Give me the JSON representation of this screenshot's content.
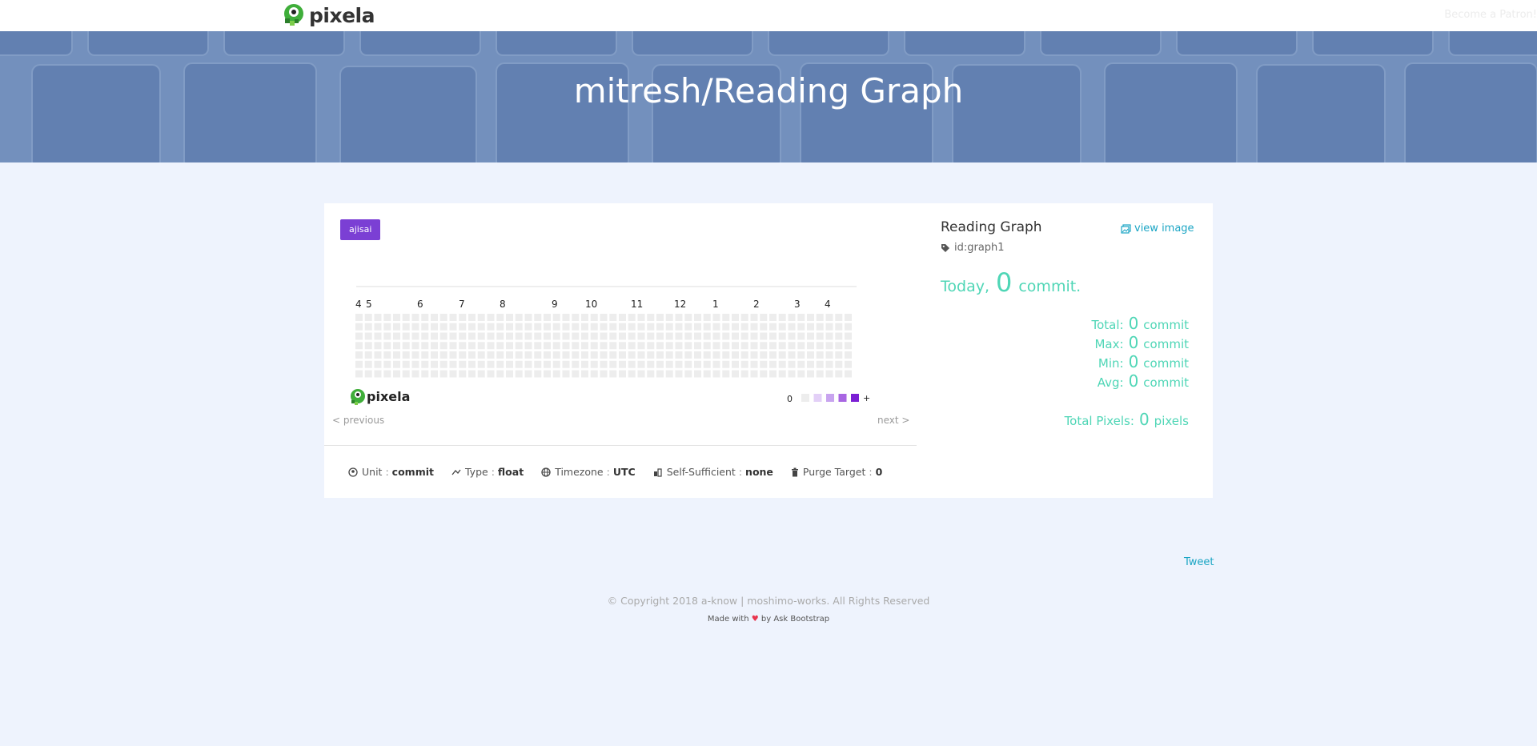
{
  "navbar": {
    "brand": "pixela",
    "patron_link": "Become a Patron!"
  },
  "hero": {
    "title": "mitresh/Reading Graph"
  },
  "graph": {
    "theme_badge": "ajisai",
    "month_labels": [
      "4",
      "5",
      "6",
      "7",
      "8",
      "9",
      "10",
      "11",
      "12",
      "1",
      "2",
      "3",
      "4"
    ],
    "brand": "pixela",
    "legend_low": "0",
    "legend_high": "+",
    "legend_colors": [
      "#ededed",
      "#e3d0f7",
      "#c8a4ef",
      "#a866e2",
      "#7b1fd4"
    ],
    "empty_cell_color": "#ededed",
    "weeks": 53,
    "prev_link": "< previous",
    "next_link": "next >"
  },
  "properties": {
    "unit_label": "Unit",
    "unit_value": "commit",
    "type_label": "Type",
    "type_value": "float",
    "timezone_label": "Timezone",
    "timezone_value": "UTC",
    "self_sufficient_label": "Self-Sufficient",
    "self_sufficient_value": "none",
    "purge_label": "Purge Target",
    "purge_value": "0",
    "separator": ":"
  },
  "panel": {
    "title": "Reading Graph",
    "view_image": "view image",
    "id": "id:graph1",
    "today_label": "Today",
    "today_comma": ",",
    "today_value": "0",
    "today_unit": "commit.",
    "stats": {
      "total_label": "Total:",
      "total_value": "0",
      "max_label": "Max:",
      "max_value": "0",
      "min_label": "Min:",
      "min_value": "0",
      "avg_label": "Avg:",
      "avg_value": "0",
      "unit": "commit",
      "pixels_label": "Total Pixels:",
      "pixels_value": "0",
      "pixels_unit": "pixels"
    }
  },
  "footer": {
    "tweet": "Tweet",
    "copyright": "© Copyright 2018 a-know | moshimo-works. All Rights Reserved",
    "made_with_prefix": "Made with",
    "heart": "♥",
    "made_with_suffix": "by Ask Bootstrap"
  },
  "colors": {
    "accent": "#4fd6b6",
    "link": "#1ba5c4",
    "badge": "#7b3fd4"
  }
}
